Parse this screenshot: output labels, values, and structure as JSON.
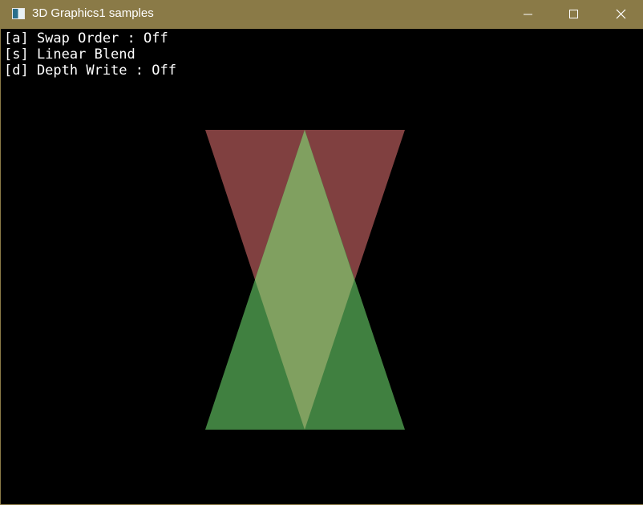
{
  "window": {
    "title": "3D Graphics1 samples",
    "titlebar_color": "#8a7a47",
    "icon": "app-window-icon"
  },
  "caption_buttons": {
    "minimize": "minimize-icon",
    "maximize": "maximize-icon",
    "close": "close-icon"
  },
  "menu": {
    "items": [
      {
        "text": "[a] Swap Order : Off"
      },
      {
        "text": "[s] Linear Blend"
      },
      {
        "text": "[d] Depth Write : Off"
      }
    ]
  },
  "scene": {
    "background": "#000000",
    "triangles": [
      {
        "name": "red-triangle-inverted",
        "color": "#804040"
      },
      {
        "name": "green-triangle-upright",
        "color": "#408040"
      },
      {
        "name": "overlap-blend",
        "color": "#80a060"
      }
    ]
  }
}
